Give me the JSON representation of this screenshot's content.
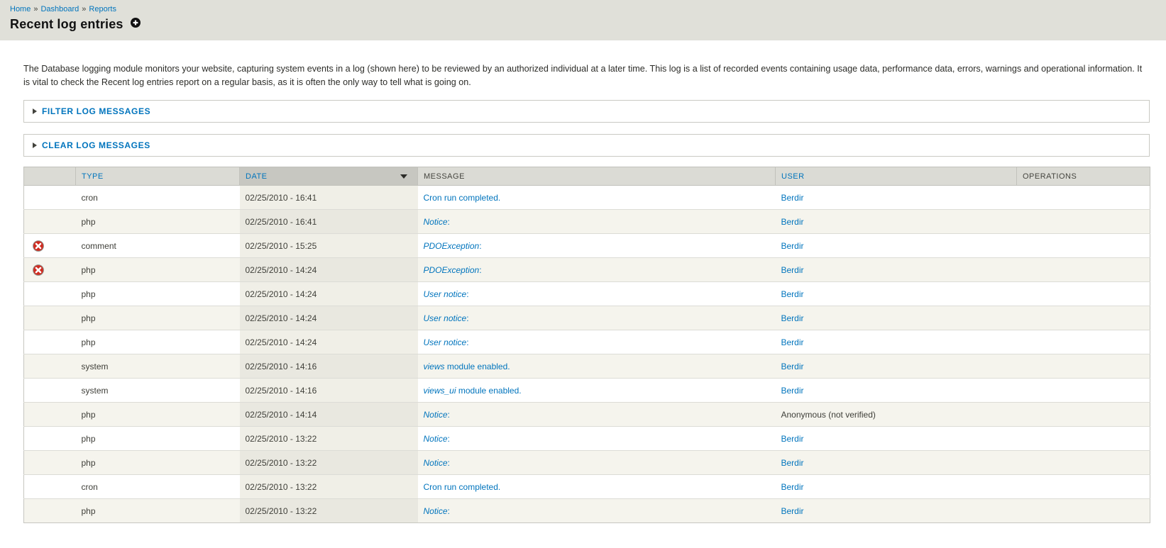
{
  "breadcrumb": {
    "separator": "»",
    "items": [
      {
        "label": "Home"
      },
      {
        "label": "Dashboard"
      },
      {
        "label": "Reports"
      }
    ]
  },
  "page": {
    "title": "Recent log entries"
  },
  "description": "The Database logging module monitors your website, capturing system events in a log (shown here) to be reviewed by an authorized individual at a later time. This log is a list of recorded events containing usage data, performance data, errors, warnings and operational information. It is vital to check the Recent log entries report on a regular basis, as it is often the only way to tell what is going on.",
  "panels": [
    {
      "label": "FILTER LOG MESSAGES"
    },
    {
      "label": "CLEAR LOG MESSAGES"
    }
  ],
  "table": {
    "headers": [
      {
        "label": "",
        "link": false
      },
      {
        "label": "TYPE",
        "link": true
      },
      {
        "label": "DATE",
        "link": true,
        "sort": "desc"
      },
      {
        "label": "MESSAGE",
        "link": false
      },
      {
        "label": "USER",
        "link": true
      },
      {
        "label": "OPERATIONS",
        "link": false
      }
    ],
    "rows": [
      {
        "error_icon": false,
        "type": "cron",
        "date": "02/25/2010 - 16:41",
        "date_error": false,
        "message_em": "",
        "message_text": "Cron run completed.",
        "user": "Berdir",
        "user_is_link": true
      },
      {
        "error_icon": false,
        "type": "php",
        "date": "02/25/2010 - 16:41",
        "date_error": false,
        "message_em": "Notice",
        "message_text": ":",
        "user": "Berdir",
        "user_is_link": true
      },
      {
        "error_icon": true,
        "type": "comment",
        "date": "02/25/2010 - 15:25",
        "date_error": false,
        "message_em": "PDOException",
        "message_text": ":",
        "user": "Berdir",
        "user_is_link": true
      },
      {
        "error_icon": true,
        "type": "php",
        "date": "02/25/2010 - 14:24",
        "date_error": true,
        "message_em": "PDOException",
        "message_text": ":",
        "user": "Berdir",
        "user_is_link": true
      },
      {
        "error_icon": false,
        "type": "php",
        "date": "02/25/2010 - 14:24",
        "date_error": false,
        "message_em": "User notice",
        "message_text": ":",
        "user": "Berdir",
        "user_is_link": true
      },
      {
        "error_icon": false,
        "type": "php",
        "date": "02/25/2010 - 14:24",
        "date_error": false,
        "message_em": "User notice",
        "message_text": ":",
        "user": "Berdir",
        "user_is_link": true
      },
      {
        "error_icon": false,
        "type": "php",
        "date": "02/25/2010 - 14:24",
        "date_error": false,
        "message_em": "User notice",
        "message_text": ":",
        "user": "Berdir",
        "user_is_link": true
      },
      {
        "error_icon": false,
        "type": "system",
        "date": "02/25/2010 - 14:16",
        "date_error": false,
        "message_em": "views",
        "message_text": " module enabled.",
        "user": "Berdir",
        "user_is_link": true
      },
      {
        "error_icon": false,
        "type": "system",
        "date": "02/25/2010 - 14:16",
        "date_error": false,
        "message_em": "views_ui",
        "message_text": " module enabled.",
        "user": "Berdir",
        "user_is_link": true
      },
      {
        "error_icon": false,
        "type": "php",
        "date": "02/25/2010 - 14:14",
        "date_error": false,
        "message_em": "Notice",
        "message_text": ":",
        "user": "Anonymous (not verified)",
        "user_is_link": false
      },
      {
        "error_icon": false,
        "type": "php",
        "date": "02/25/2010 - 13:22",
        "date_error": false,
        "message_em": "Notice",
        "message_text": ":",
        "user": "Berdir",
        "user_is_link": true
      },
      {
        "error_icon": false,
        "type": "php",
        "date": "02/25/2010 - 13:22",
        "date_error": false,
        "message_em": "Notice",
        "message_text": ":",
        "user": "Berdir",
        "user_is_link": true
      },
      {
        "error_icon": false,
        "type": "cron",
        "date": "02/25/2010 - 13:22",
        "date_error": false,
        "message_em": "",
        "message_text": "Cron run completed.",
        "user": "Berdir",
        "user_is_link": true
      },
      {
        "error_icon": false,
        "type": "php",
        "date": "02/25/2010 - 13:22",
        "date_error": false,
        "message_em": "Notice",
        "message_text": ":",
        "user": "Berdir",
        "user_is_link": true
      }
    ]
  },
  "icons": {
    "help": "plus-in-black-circle",
    "error": "white-x-in-red-circle",
    "sort": "triangle-down",
    "collapse": "triangle-right"
  },
  "colors": {
    "accent_link": "#0074bd",
    "topbar_bg": "#e0e0d9",
    "error_icon_red": "#d02b20",
    "error_cell_bg": "#ecbcb7",
    "stripe_bg": "#f5f4ed",
    "active_col_on_white": "#f0efe7",
    "active_col_on_stripe": "#e9e8e0",
    "header_bg": "#dbdbd5",
    "header_active_bg": "#c7c7c1"
  }
}
